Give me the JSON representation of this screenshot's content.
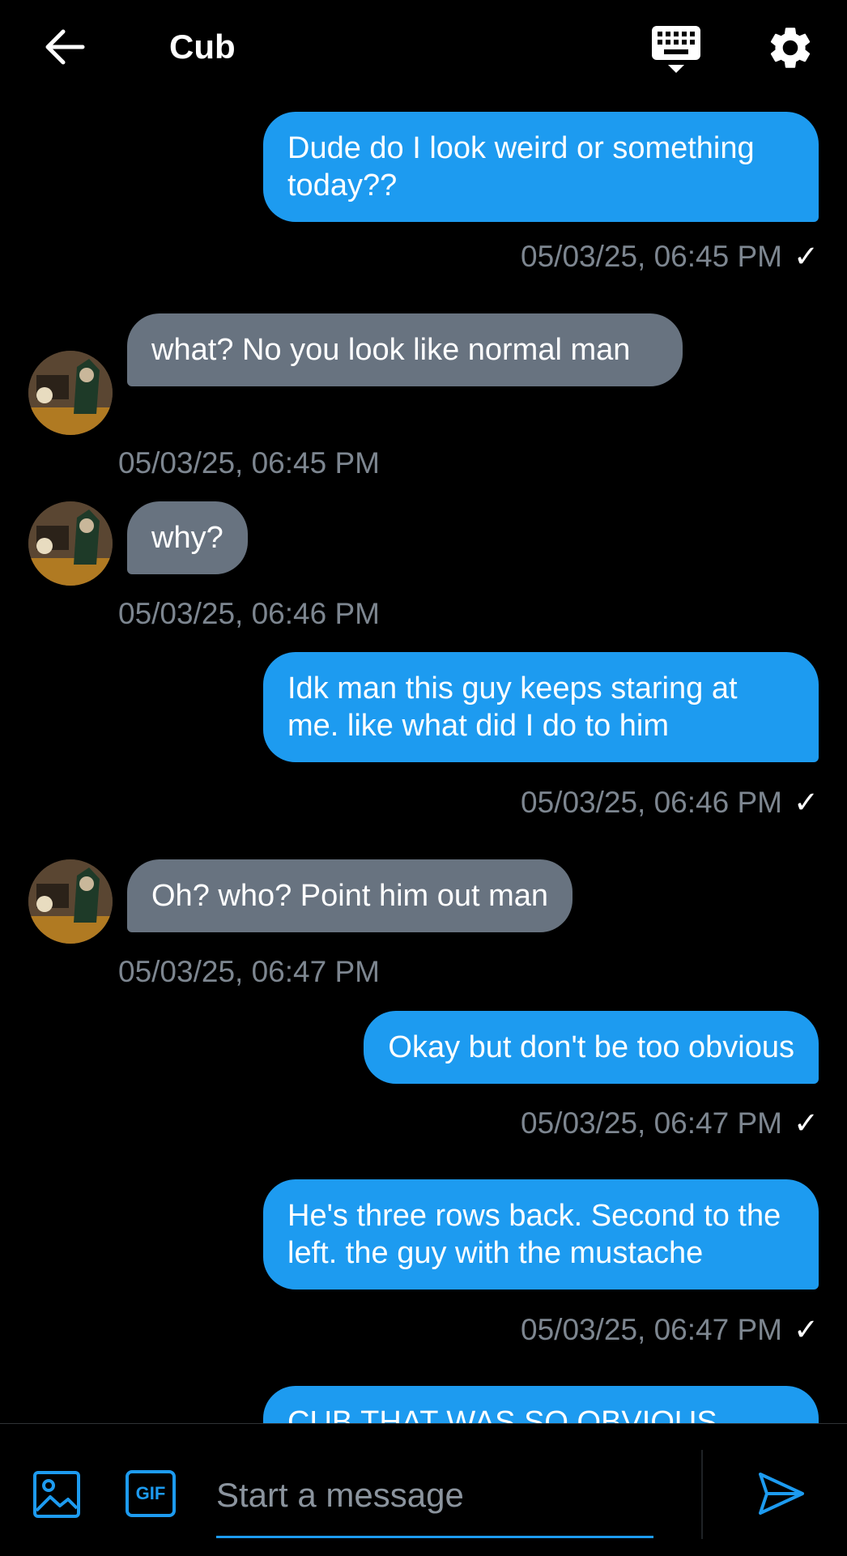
{
  "header": {
    "title": "Cub",
    "back_icon": "arrow-left-icon",
    "keyboard_icon": "keyboard-icon",
    "settings_icon": "gear-icon"
  },
  "messages": [
    {
      "direction": "out",
      "text": "Dude do I look weird or something today??",
      "time": "05/03/25, 06:45 PM",
      "read_mark": "✓"
    },
    {
      "direction": "in",
      "text": "what? No you look like normal man",
      "time": "05/03/25, 06:45 PM"
    },
    {
      "direction": "in",
      "text": "why?",
      "time": "05/03/25, 06:46 PM"
    },
    {
      "direction": "out",
      "text": "Idk man this guy keeps staring at me. like what did I do to him",
      "time": "05/03/25, 06:46 PM",
      "read_mark": "✓"
    },
    {
      "direction": "in",
      "text": "Oh? who? Point him out man",
      "time": "05/03/25, 06:47 PM"
    },
    {
      "direction": "out",
      "text": "Okay but don't be too obvious",
      "time": "05/03/25, 06:47 PM",
      "read_mark": "✓"
    },
    {
      "direction": "out",
      "text": "He's three rows back. Second to the left. the guy with the mustache",
      "time": "05/03/25, 06:47 PM",
      "read_mark": "✓"
    },
    {
      "direction": "out",
      "text": "CUB THAT WAS SO OBVIOUS OMG"
    }
  ],
  "composer": {
    "image_icon": "image-icon",
    "gif_label": "GIF",
    "placeholder": "Start a message",
    "send_icon": "send-icon"
  },
  "colors": {
    "accent": "#1d9bf0",
    "incoming_bubble": "#687380",
    "timestamp": "#7d8690",
    "background": "#000000"
  }
}
